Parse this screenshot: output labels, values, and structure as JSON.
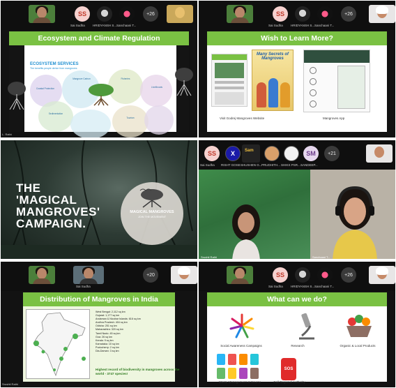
{
  "panels": {
    "p1": {
      "participants": [
        "Sai Sudha",
        "HRIDYANSH S...",
        "Sanchaani T..."
      ],
      "avatar_initials": "SS",
      "more_count": "+26",
      "slide_title": "Ecosystem and Climate Regulation",
      "subtitle": "ECOSYSTEM SERVICES",
      "subtitle_note": "The benefits people derive from mangroves",
      "blocks": [
        "Coastal Protection",
        "Mangrove Carbon",
        "Fisheries",
        "Livelihoods",
        "Sedimentation",
        "Tourism"
      ],
      "speaker": "L. Rathi"
    },
    "p2": {
      "participants": [
        "Sai Sudha",
        "HRIDYANSH S...",
        "Sanchaani T..."
      ],
      "avatar_initials": "SS",
      "more_count": "+26",
      "slide_title": "Wish to Learn More?",
      "book_title": "Many Secrets of Mangroves",
      "caption_left": "Visit Godrej Mangroves Website",
      "caption_right": "Mangroves App"
    },
    "p3": {
      "title_lines": [
        "THE",
        "'MAGICAL",
        "MANGROVES'",
        "CAMPAIGN."
      ],
      "logo_title": "MAGICAL MANGROVES",
      "logo_sub": "JOIN THE MOVEMENT"
    },
    "p4": {
      "participants": [
        "Sai Sudha",
        "RISHT GOSE",
        "SHUSHEN G...",
        "PRUDHITH...",
        "SHIKS PSR...",
        "SANDEEP..."
      ],
      "avatar_initials": "SS",
      "avatar2": "SM",
      "more_count": "+21",
      "label_left": "Srushti Rathi",
      "label_right": "Sanchaani T..."
    },
    "p5": {
      "participants": [
        "Sai Sudha"
      ],
      "more_count": "+20",
      "slide_title": "Distribution of Mangroves in India",
      "states": [
        "West Bengal: 2,112 sq km",
        "Gujarat: 1,177 sq km",
        "Andaman & Nicobar Islands: 616 sq km",
        "Andhra Pradesh: 404 sq km",
        "Odisha: 251 sq km",
        "Maharashtra: 320 sq km",
        "Tamil Nadu: 45 sq km",
        "Goa: 26 sq km",
        "Kerala: 9 sq km",
        "Karnataka: 10 sq km",
        "Puducherry: 2 sq km",
        "Dia-Daman: 3 sq km"
      ],
      "highlight": "Highest record of biodiversity in mangroves across the world - 3747 species!",
      "speaker": "Srushti Rathi"
    },
    "p6": {
      "participants": [
        "Sai Sudha",
        "HRIDYANSH S...",
        "Sanchaani T..."
      ],
      "avatar_initials": "SS",
      "more_count": "+26",
      "slide_title": "What can we do?",
      "items": [
        "Social Awareness Campaigns",
        "Research",
        "Organic & Local Products",
        "Waste Management at Source",
        "Call Regional Authority"
      ],
      "sos": "SOS"
    }
  }
}
